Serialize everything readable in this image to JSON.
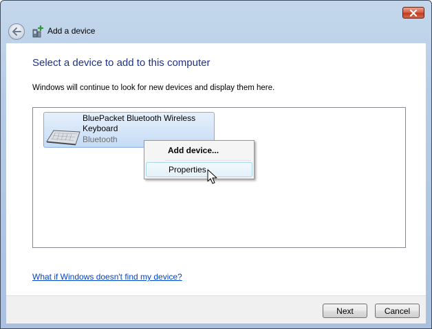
{
  "window": {
    "title": "Add a device",
    "close_icon": "close-x-icon",
    "back_icon": "back-arrow-icon",
    "device_icon": "add-device-icon"
  },
  "main": {
    "title": "Select a device to add to this computer",
    "subtitle": "Windows will continue to look for new devices and display them here."
  },
  "devices": [
    {
      "name": "BluePacket Bluetooth Wireless Keyboard",
      "type": "Bluetooth",
      "icon": "keyboard-icon"
    }
  ],
  "context_menu": {
    "items": [
      {
        "label": "Add device..."
      },
      {
        "label": "Properties"
      }
    ]
  },
  "help_link": "What if Windows doesn't find my device?",
  "footer": {
    "next_label": "Next",
    "cancel_label": "Cancel"
  },
  "colors": {
    "title_blue": "#1e3287",
    "link_blue": "#0044cc",
    "selection_border": "#84acdd"
  }
}
